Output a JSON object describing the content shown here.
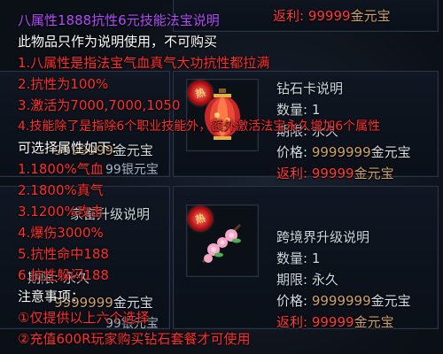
{
  "shop": {
    "card_top_right": {
      "rebate_label": "返利:",
      "rebate_amount": "99999",
      "rebate_unit": "金元宝"
    },
    "card_diamond": {
      "name": "钻石卡说明",
      "quantity_label": "数量:",
      "quantity_value": "1",
      "duration_label": "期限:",
      "duration_value": "永久",
      "price_label": "价格:",
      "price_value": "9999999",
      "price_unit": "金元宝",
      "rebate_label": "返利:",
      "rebate_amount": "99999",
      "rebate_unit": "金元宝"
    },
    "card_realm": {
      "name": "跨境界升级说明",
      "quantity_label": "数量:",
      "quantity_value": "1",
      "duration_label": "期限:",
      "duration_value": "永久",
      "price_label": "价格:",
      "price_value": "9999999",
      "price_unit": "金元宝",
      "rebate_label": "返利:",
      "rebate_amount": "99999",
      "rebate_unit": "金元宝"
    },
    "card_left_mid": {
      "price_value": "9999999",
      "price_unit": "金元宝",
      "sub_label": "99银元宝"
    },
    "card_left_bottom": {
      "name": "家畜升级说明",
      "duration_label": "期限:",
      "duration_value": "永久",
      "price_value": "9999999",
      "price_unit": "金元宝",
      "sub_label": "99银元宝"
    }
  },
  "tooltip": {
    "title": "八属性1888抗性6元技能法宝说明",
    "intro": "此物品只作为说明使用，不可购买",
    "rule1": "1.八属性是指法宝气血真气大功抗性都拉满",
    "rule2": "2.抗性为100%",
    "rule3": "3.激活为7000,7000,1050",
    "rule4": "4.技能除了是指除6个职业技能外，额外激活法宝永久增加6个属性",
    "options_header": "可选择属性如下：",
    "opt1": "1.1800%气血",
    "opt2": "2.1800%真气",
    "opt3": "3.1200%攻击",
    "opt4": "4.爆伤3000%",
    "opt5": "5.抗性命中188",
    "opt6": "6.抗性躲闪188",
    "notes_header": "注意事项：",
    "note1": "①仅提供以上六个选择",
    "note2": "②充值600R玩家购买钻石套餐才可使用"
  },
  "colors": {
    "title_purple": "#b44cff",
    "rule_red": "#ff2f2f",
    "gold": "#cfa16b"
  },
  "icons": {
    "lantern": "lantern-icon",
    "flower": "plum-blossom-icon",
    "hot_badge": "hot-badge-icon"
  },
  "badge": {
    "hot_text": "热"
  }
}
